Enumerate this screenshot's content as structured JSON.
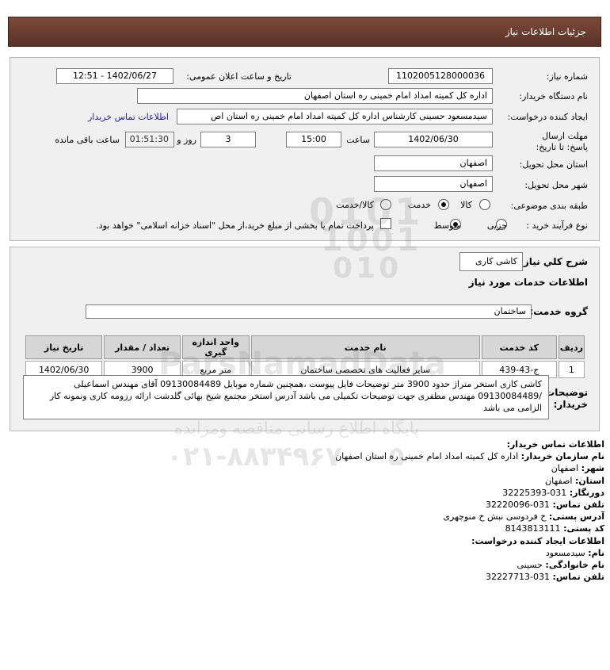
{
  "page_title": "جزئیات اطلاعات نیاز",
  "details": {
    "need_number_label": "شماره نیاز:",
    "need_number": "1102005128000036",
    "announce_label": "تاریخ و ساعت اعلان عمومی:",
    "announce_value": "1402/06/27 - 12:51",
    "buyer_org_label": "نام دستگاه خریدار:",
    "buyer_org": "اداره کل کمیته امداد امام خمینی  ره  استان اصفهان",
    "creator_label": "ایجاد کننده درخواست:",
    "creator": "سیدمسعود حسینی کارشناس اداره کل کمیته امداد امام خمینی  ره  استان اص",
    "contact_link": "اطلاعات تماس خریدار",
    "deadline_label": "مهلت ارسال پاسخ: تا تاریخ:",
    "deadline_date": "1402/06/30",
    "time_label": "ساعت",
    "deadline_time": "15:00",
    "days_value": "3",
    "days_label": "روز و",
    "countdown": "01:51:30",
    "remaining_label": "ساعت باقی مانده",
    "province_label": "استان محل تحویل:",
    "province": "اصفهان",
    "city_label": "شهر محل تحویل:",
    "city": "اصفهان",
    "category_label": "طبقه بندی موضوعی:",
    "category_options": [
      "کالا",
      "خدمت",
      "کالا/خدمت"
    ],
    "category_selected": "خدمت",
    "process_label": "نوع فرآیند خرید :",
    "process_options": [
      "جزیی",
      "متوسط"
    ],
    "process_selected": "متوسط",
    "payment_note": "پرداخت تمام یا بخشی از مبلغ خرید،از محل \"اسناد خزانه اسلامی\" خواهد بود."
  },
  "need": {
    "general_label": "شرح کلي نياز:",
    "general_value": "کاشی کاری",
    "services_heading": "اطلاعات خدمات مورد نیاز",
    "group_label": "گروه خدمت:",
    "group_value": "ساختمان",
    "table": {
      "headers": [
        "ردیف",
        "کد خدمت",
        "نام خدمت",
        "واحد اندازه گیری",
        "تعداد / مقدار",
        "تاریخ نیاز"
      ],
      "rows": [
        [
          "1",
          "ج-43-439",
          "سایر فعالیت های تخصصی ساختمان",
          "متر مربع",
          "3900",
          "1402/06/30"
        ]
      ]
    },
    "buyer_notes_label": "توضیحات خریدار:",
    "buyer_notes": "کاشی کاری استخر متراژ حدود 3900 متر توضیحات فایل پیوست ،همچنین شماره موبایل 09130084489 آقای مهندس اسماعیلی /09130084489 مهندس مظفری جهت توضیحات تکمیلی می باشد آدرس استخر مجتمع شیخ بهائی گلدشت ارائه رزومه کاری ونمونه کار الزامی می باشد"
  },
  "contact": {
    "buyer_heading": "اطلاعات تماس خریدار:",
    "org_label": "نام سازمان خریدار:",
    "org": "اداره کل کمیته امداد امام خمینی ره استان اصفهان",
    "city_label": "شهر:",
    "city": "اصفهان",
    "province_label": "استان:",
    "province": "اصفهان",
    "fax_label": "دورنگار:",
    "fax": "031-32225393",
    "phone_label": "تلفن تماس:",
    "phone": "031-32220096",
    "address_label": "آدرس پستی:",
    "address": "خ فردوسی نبش خ منوچهری",
    "postal_label": "کد پستی:",
    "postal": "8143813111",
    "creator_heading": "اطلاعات ایجاد کننده درخواست:",
    "first_label": "نام:",
    "first": "سیدمسعود",
    "last_label": "نام خانوادگی:",
    "last": "حسینی",
    "creator_phone_label": "تلفن تماس:",
    "creator_phone": "031-32227713"
  },
  "watermark": {
    "digits_1": "0101",
    "digits_2": "1001",
    "digits_3": "010",
    "site": "ParsNamadData",
    "slogan": "پایگاه اطلاع رسانی مناقصه ومزایده",
    "phone": "۰۲۱-۸۸۳۴۹۶۷۰ - ۵"
  }
}
